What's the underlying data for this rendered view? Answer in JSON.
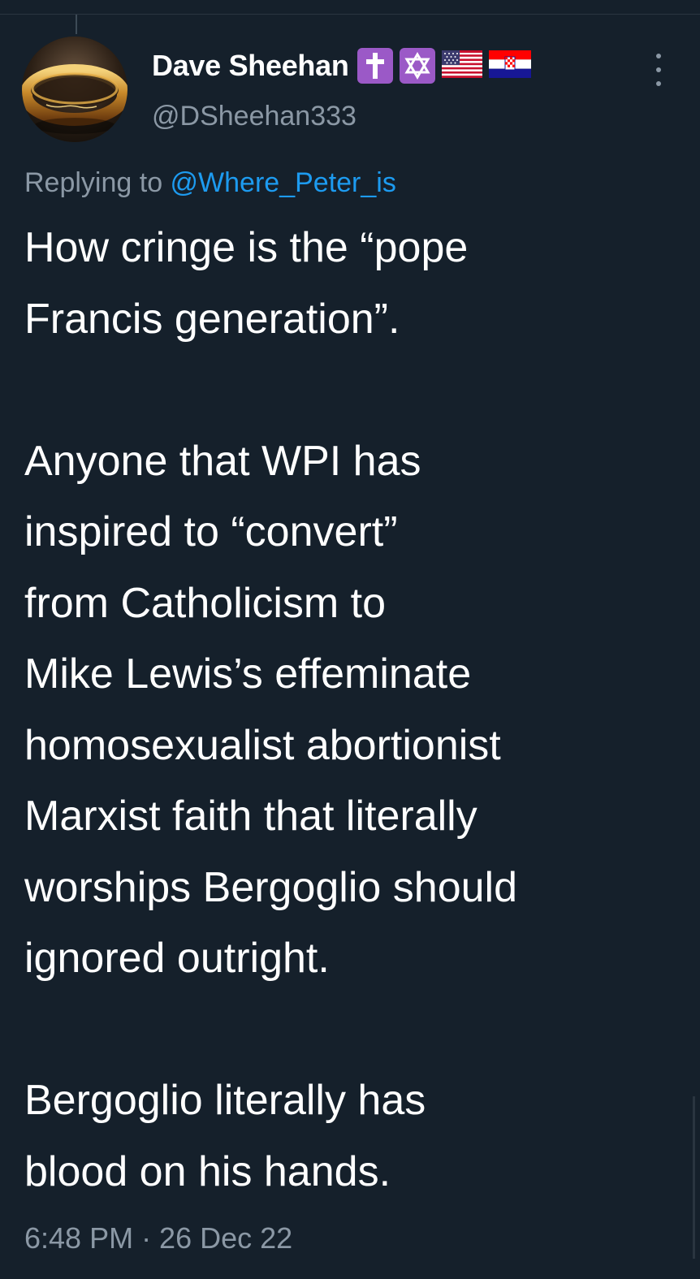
{
  "tweet": {
    "author": {
      "display_name": "Dave Sheehan",
      "handle": "@DSheehan333",
      "avatar_icon": "golden-ring-avatar",
      "badges": [
        "latin-cross-emoji",
        "star-of-david-emoji",
        "us-flag-emoji",
        "croatia-flag-emoji"
      ]
    },
    "reply_prefix": "Replying to ",
    "reply_to": "@Where_Peter_is",
    "text_lines": [
      "How cringe is the “pope",
      "Francis generation”.",
      "",
      "Anyone that WPI has",
      "inspired to “convert”",
      "from Catholicism to",
      "Mike Lewis’s effeminate",
      "homosexualist abortionist",
      "Marxist faith that literally",
      "worships Bergoglio should",
      "ignored outright.",
      "",
      "Bergoglio literally has",
      "blood on his hands."
    ],
    "timestamp": "6:48 PM · 26 Dec 22"
  },
  "colors": {
    "background": "#15202b",
    "text": "#ffffff",
    "secondary": "#8b98a5",
    "link": "#1d9bf0",
    "emoji_purple": "#9b59c7"
  }
}
